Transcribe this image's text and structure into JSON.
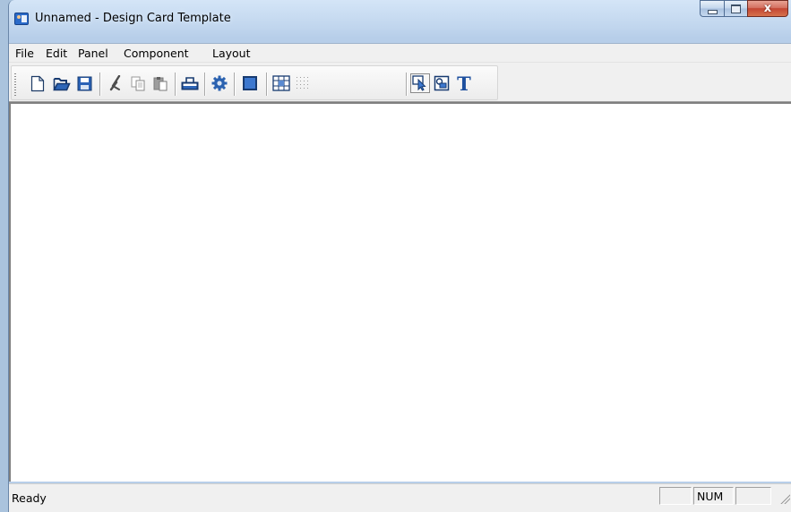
{
  "window": {
    "title": "Unnamed - Design Card Template",
    "close_glyph": "x"
  },
  "menu": [
    "File",
    "Edit",
    "Panel",
    "Component",
    "Layout"
  ],
  "toolbar": {
    "buttons": [
      {
        "name": "new",
        "icon": "new-document-icon"
      },
      {
        "name": "open",
        "icon": "open-folder-icon"
      },
      {
        "name": "save",
        "icon": "save-icon"
      },
      {
        "name": "cut",
        "icon": "cut-icon"
      },
      {
        "name": "copy",
        "icon": "copy-icon"
      },
      {
        "name": "paste",
        "icon": "paste-icon"
      },
      {
        "name": "print",
        "icon": "print-icon"
      },
      {
        "name": "settings",
        "icon": "gear-icon"
      },
      {
        "name": "panel",
        "icon": "panel-icon"
      },
      {
        "name": "grid",
        "icon": "grid-icon"
      },
      {
        "name": "dot-grid",
        "icon": "dot-grid-icon"
      },
      {
        "name": "select",
        "icon": "select-pointer-icon",
        "active": true
      },
      {
        "name": "image",
        "icon": "image-component-icon"
      },
      {
        "name": "text",
        "icon": "text-tool-icon",
        "glyph": "T"
      }
    ]
  },
  "status": {
    "text": "Ready",
    "panes": [
      "",
      "NUM",
      ""
    ]
  },
  "colors": {
    "titlebar": "#c1d6ee",
    "accent_blue": "#2a6ac9",
    "close_red": "#c44633",
    "chrome": "#f0f0f0"
  }
}
